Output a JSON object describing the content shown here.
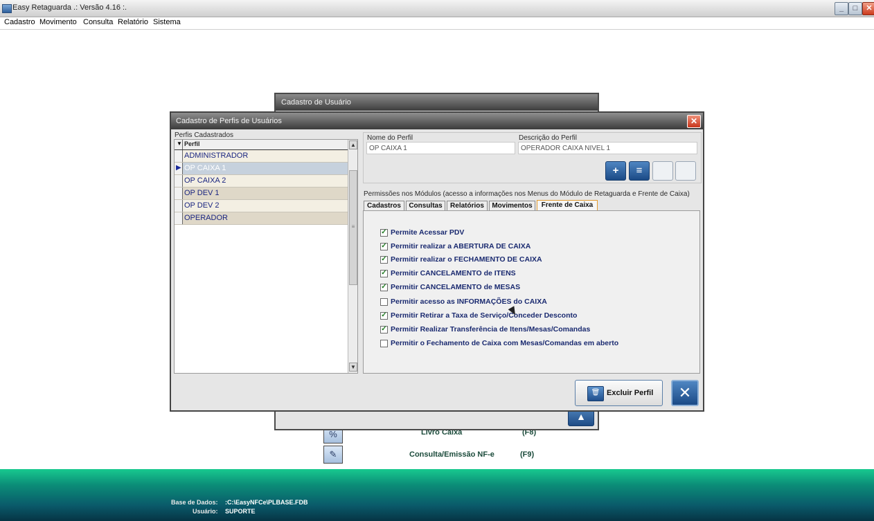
{
  "app": {
    "title": "Easy Retaguarda .: Versão 4.16 :.",
    "window_buttons": {
      "min": "_",
      "max": "□",
      "close": "✕"
    }
  },
  "menu": [
    "Cadastro",
    "Movimento",
    "Consulta",
    "Relatório",
    "Sistema"
  ],
  "background_dialog": {
    "title": "Cadastro de Usuário",
    "up_button": "▲",
    "shortcuts": [
      {
        "icon": "percent-icon",
        "glyph": "%",
        "label": "Livro Caixa",
        "key": "(F8)"
      },
      {
        "icon": "document-edit-icon",
        "glyph": "✎",
        "label": "Consulta/Emissão NF-e",
        "key": "(F9)"
      }
    ]
  },
  "dialog": {
    "title": "Cadastro de Perfis de Usuários",
    "close_glyph": "✕",
    "profiles_label": "Perfis Cadastrados",
    "grid": {
      "indicator_header": "▼",
      "column": "Perfil",
      "rows": [
        "ADMINISTRADOR",
        "OP CAIXA 1",
        "OP CAIXA 2",
        "OP DEV 1",
        "OP DEV 2",
        "OPERADOR"
      ],
      "selected_indicator": "▶",
      "scroll_up": "▲",
      "scroll_down": "▼",
      "thumb_grip": "≡"
    },
    "form": {
      "name_label": "Nome do Perfil",
      "name_value": "OP CAIXA 1",
      "desc_label": "Descrição do Perfil",
      "desc_value": "OPERADOR CAIXA NIVEL 1",
      "add_glyph": "+",
      "list_glyph": "≡"
    },
    "permissions_label": "Permissões nos Módulos (acesso a informações nos Menus do Módulo de Retaguarda e Frente de Caixa)",
    "tabs": [
      "Cadastros",
      "Consultas",
      "Relatórios",
      "Movimentos",
      "Frente de Caixa"
    ],
    "active_tab": "Frente de Caixa",
    "check_glyph": "✓",
    "permissions": [
      {
        "label": "Permite Acessar PDV",
        "checked": true
      },
      {
        "label": "Permitir realizar a ABERTURA DE CAIXA",
        "checked": true
      },
      {
        "label": "Permitir realizar o FECHAMENTO DE CAIXA",
        "checked": true
      },
      {
        "label": "Permitir CANCELAMENTO de ITENS",
        "checked": true
      },
      {
        "label": "Permitir CANCELAMENTO de MESAS",
        "checked": true
      },
      {
        "label": "Permitir acesso as INFORMAÇÕES do CAIXA",
        "checked": false
      },
      {
        "label": "Permitir Retirar a Taxa de Serviço/Conceder Desconto",
        "checked": true
      },
      {
        "label": "Permitir Realizar Transferência de Itens/Mesas/Comandas",
        "checked": true
      },
      {
        "label": "Permitir o Fechamento de Caixa com Mesas/Comandas em aberto",
        "checked": false
      }
    ],
    "delete_button": "Excluir Perfil",
    "delete_glyph": "🗑",
    "exit_glyph": "✕"
  },
  "status": {
    "db_label": "Base de Dados:",
    "db_value": ":C:\\EasyNFCe\\PLBASE.FDB",
    "user_label": "Usuário:",
    "user_value": "SUPORTE"
  }
}
